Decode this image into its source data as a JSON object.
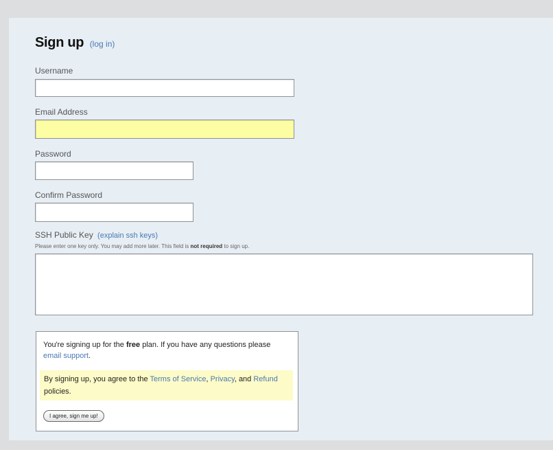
{
  "form": {
    "title": "Sign up",
    "login_link": "(log in)",
    "username": {
      "label": "Username",
      "value": ""
    },
    "email": {
      "label": "Email Address",
      "value": ""
    },
    "password": {
      "label": "Password",
      "value": ""
    },
    "confirm_password": {
      "label": "Confirm Password",
      "value": ""
    },
    "ssh_key": {
      "label": "SSH Public Key",
      "explain_link": "(explain ssh keys)",
      "hint_pre": "Please enter one key only. You may add more later. This field is",
      "hint_bold": "not required",
      "hint_post": "to sign up.",
      "value": ""
    }
  },
  "plan": {
    "text_pre": "You're signing up for the",
    "plan_name": "free",
    "text_mid": "plan. If you have any questions please",
    "support_link": "email support",
    "text_end": "."
  },
  "agreement": {
    "text_pre": "By signing up, you agree to the",
    "terms_link": "Terms of Service",
    "comma": ",",
    "privacy_link": "Privacy",
    "and": ", and",
    "refund_link": "Refund",
    "text_end": "policies."
  },
  "submit_button": "I agree, sign me up!",
  "colors": {
    "panel_bg": "#e7eef4",
    "link": "#4a79b4",
    "email_highlight": "#fdfda4",
    "agreement_bg": "#fdfbc7"
  }
}
